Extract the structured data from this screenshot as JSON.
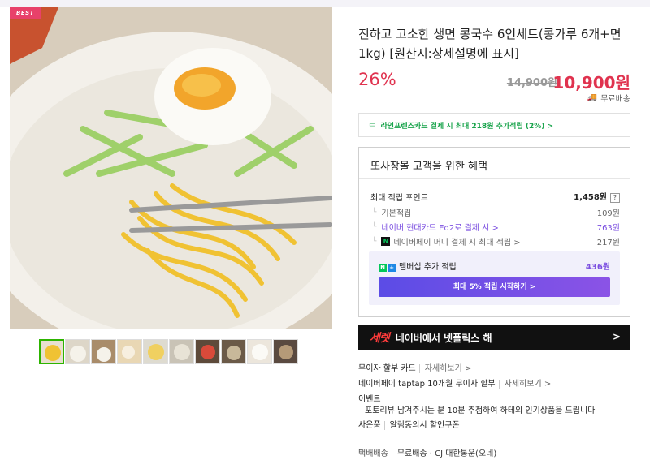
{
  "badge": "BEST",
  "product": {
    "title": "진하고 고소한 생면 콩국수 6인세트(콩가루 6개+면1kg) [원산지:상세설명에 표시]",
    "discount": "26%",
    "original_price": "14,900원",
    "price": "10,900원",
    "shipping": "무료배송"
  },
  "card_promo": "라인프렌즈카드 결제 시 최대 218원 추가적립 (2%) >",
  "benefit": {
    "title": "또사장몰 고객을 위한 혜택",
    "max_points_label": "최대 적립 포인트",
    "max_points_value": "1,458원",
    "help": "?",
    "rows": [
      {
        "label": "기본적립",
        "value": "109원"
      },
      {
        "label": "네이버 현대카드 Ed2로 결제 시 >",
        "value": "763원"
      },
      {
        "label": "네이버페이 머니 결제 시 최대 적립 >",
        "value": "217원"
      }
    ],
    "member_label": "멤버십 추가 적립",
    "member_value": "436원",
    "member_button": "최대 5% 적립 시작하기 >"
  },
  "banner": {
    "logo": "세렛",
    "text": "네이버에서 넷플릭스 해",
    "arrow": ">"
  },
  "info": {
    "installment_label": "무이자 할부 카드",
    "installment_more": "자세히보기 >",
    "taptap_label": "네이버페이 taptap 10개월 무이자 할부",
    "taptap_more": "자세히보기 >",
    "event_label": "이벤트",
    "event_text": "포토리뷰 남겨주시는 분 10분 추첨하여 하테의 인기상품을 드립니다",
    "coupon_label": "사은품",
    "coupon_text": "알림동의시 할인쿠폰",
    "delivery_label": "택배배송",
    "delivery_text": "무료배송 · CJ 대한통운(오네)"
  },
  "icons": {
    "shipping": "truck-icon",
    "card": "card-icon",
    "npay": "npay-icon"
  },
  "colors": {
    "accent_red": "#e0334f",
    "promo_green": "#17a34a",
    "member_purple": "#7b4fe0"
  }
}
